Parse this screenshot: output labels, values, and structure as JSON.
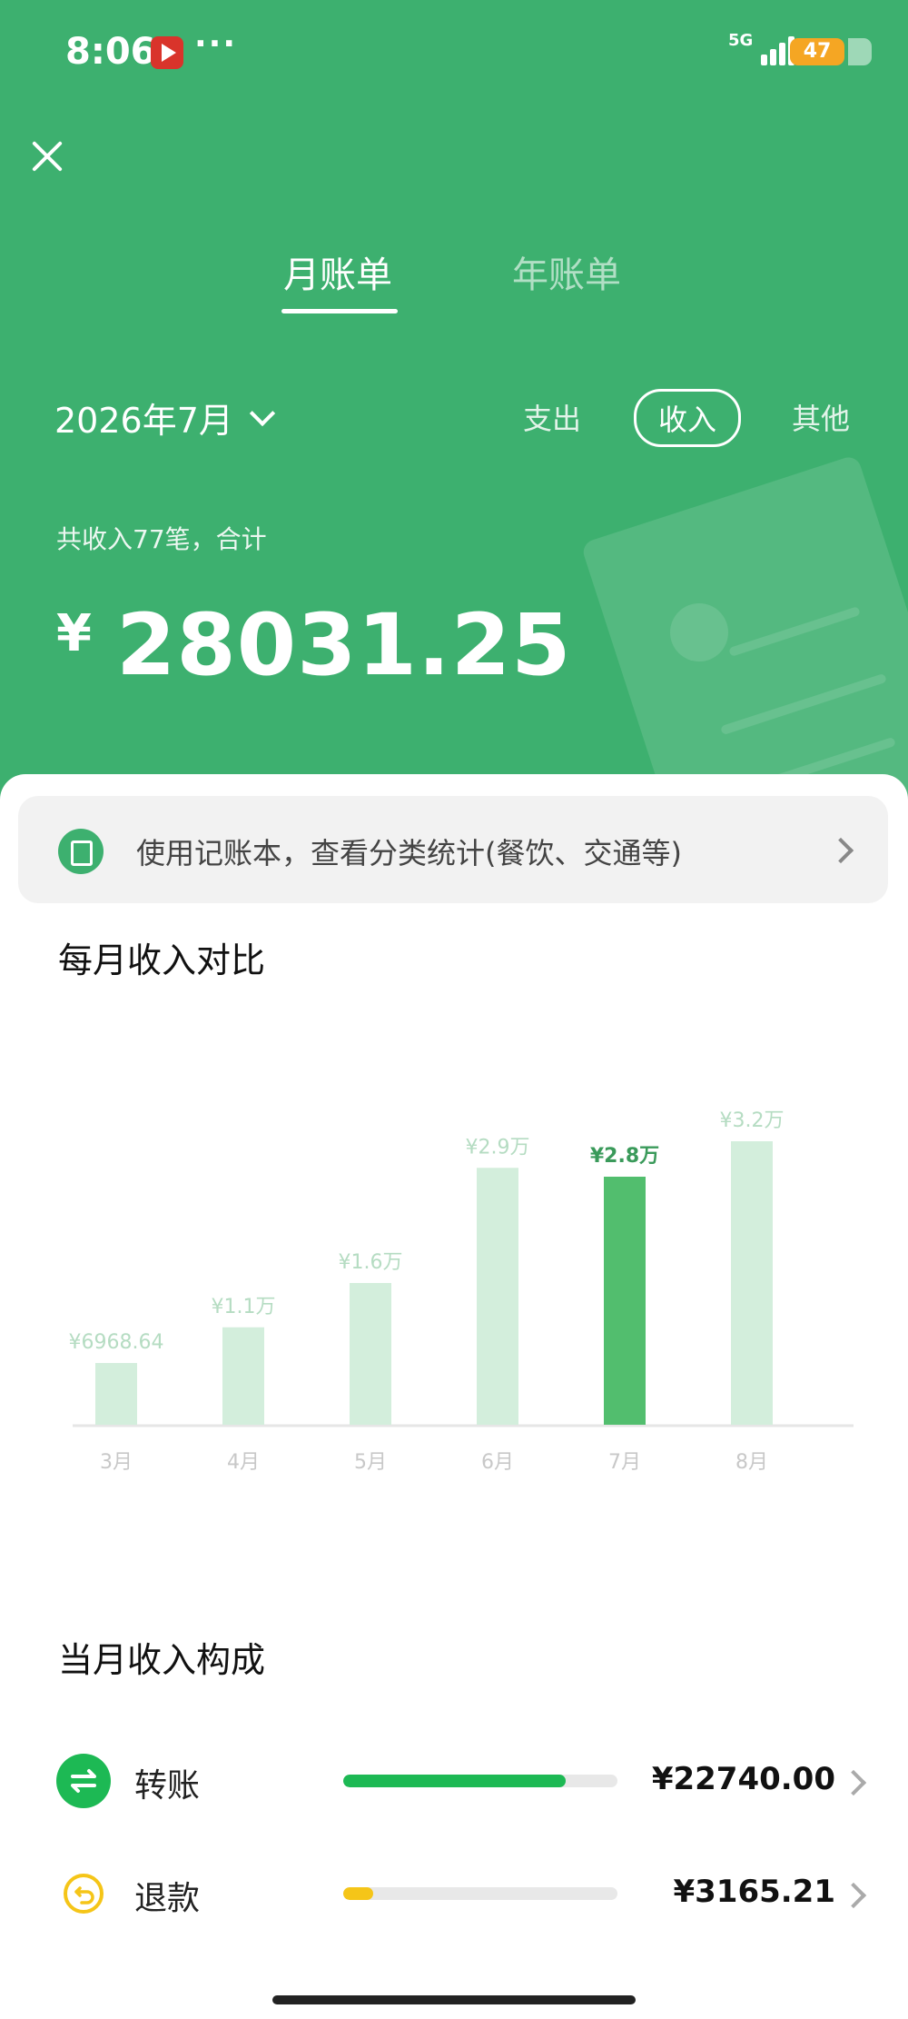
{
  "status_bar": {
    "time": "8:06",
    "more": "···",
    "network": "5G",
    "battery": "47"
  },
  "header": {
    "tabs": [
      {
        "label": "月账单",
        "active": true
      },
      {
        "label": "年账单",
        "active": false
      }
    ],
    "month": "2026年7月",
    "type_tabs": [
      {
        "label": "支出",
        "active": false
      },
      {
        "label": "收入",
        "active": true
      },
      {
        "label": "其他",
        "active": false
      }
    ],
    "summary_label": "共收入77笔，合计",
    "total_currency": "¥",
    "total_amount": "28031.25"
  },
  "banner": {
    "text": "使用记账本，查看分类统计(餐饮、交通等)"
  },
  "monthly_comparison": {
    "title": "每月收入对比"
  },
  "chart_data": {
    "type": "bar",
    "categories": [
      "3月",
      "4月",
      "5月",
      "6月",
      "7月",
      "8月"
    ],
    "values": [
      6968.64,
      11000,
      16000,
      29000,
      28000,
      32000
    ],
    "value_labels": [
      "¥6968.64",
      "¥1.1万",
      "¥1.6万",
      "¥2.9万",
      "¥2.8万",
      "¥3.2万"
    ],
    "highlight_index": 4,
    "ylim": [
      0,
      32000
    ],
    "grid": false,
    "colors": {
      "normal": "#D3EEDC",
      "highlight": "#52BE6E",
      "label_normal": "#B5DCC2",
      "label_highlight": "#3A9A5A",
      "tick": "#C8C8C8"
    }
  },
  "composition": {
    "title": "当月收入构成",
    "items": [
      {
        "label": "转账",
        "amount": "¥22740.00",
        "fraction": 0.81,
        "color": "#1DB954",
        "icon": "transfer-icon"
      },
      {
        "label": "退款",
        "amount": "¥3165.21",
        "fraction": 0.11,
        "color": "#F5C518",
        "icon": "refund-icon"
      }
    ]
  },
  "colors": {
    "header_bg": "#3DB06F",
    "accent": "#3DB06F"
  }
}
